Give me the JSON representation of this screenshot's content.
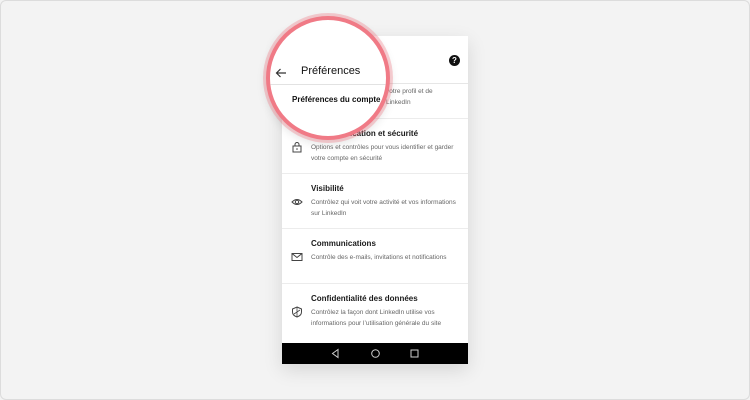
{
  "header": {
    "title": "Préférences",
    "help_icon": "question-circle-icon",
    "back_icon": "arrow-left-icon"
  },
  "magnified": {
    "section_title": "Préférences du compte",
    "behind_text_line1": "votre profil et de",
    "behind_text_line2": "LinkedIn"
  },
  "items": [
    {
      "title": "Identification et sécurité",
      "visible_title": "…ication et sécurité",
      "description": "Options et contrôles pour vous identifier et garder votre compte en sécurité",
      "icon": "lock-icon"
    },
    {
      "title": "Visibilité",
      "description": "Contrôlez qui voit votre activité et vos informations sur LinkedIn",
      "icon": "eye-icon"
    },
    {
      "title": "Communications",
      "description": "Contrôle des e-mails, invitations et notifications",
      "icon": "envelope-icon"
    },
    {
      "title": "Confidentialité des données",
      "description": "Contrôlez la façon dont LinkedIn utilise vos informations pour l’utilisation générale du site",
      "icon": "shield-icon"
    }
  ],
  "nav": {
    "back_icon": "triangle-back-icon",
    "home_icon": "circle-home-icon",
    "recent_icon": "square-recent-icon"
  },
  "colors": {
    "magnifier_ring": "#f07a86",
    "nav_bar": "#000000",
    "background": "#f3f3f3"
  }
}
